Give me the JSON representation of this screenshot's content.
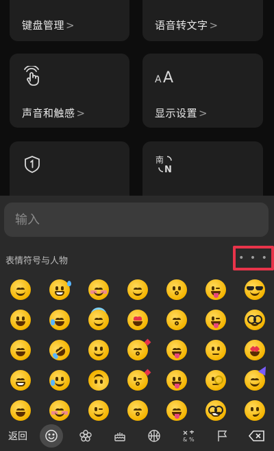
{
  "settings": {
    "keyboard_management": "键盘管理",
    "voice_to_text": "语音转文字",
    "sound_and_touch": "声音和触感",
    "display_settings": "显示设置",
    "chevron": ">"
  },
  "keyboard": {
    "input_placeholder": "输入",
    "category_title": "表情符号与人物",
    "more_label": "• • •",
    "back_label": "返回"
  },
  "emojis": [
    [
      "smile",
      "sweat-smile",
      "blush",
      "relieved",
      "kissing",
      "wink-tongue",
      "sunglasses"
    ],
    [
      "smiley",
      "joy",
      "innocent",
      "heart-eyes",
      "kissing-smiling",
      "zany",
      "disguised"
    ],
    [
      "grin-smile",
      "rofl",
      "slight-smile",
      "smiling-hearts",
      "savoring",
      "raised-eyebrow",
      "star-struck"
    ],
    [
      "grimace",
      "tear-smile",
      "upside-down",
      "kissing-heart",
      "tongue",
      "monocle",
      "partying"
    ],
    [
      "squint-laugh",
      "happy",
      "wink",
      "kissing-closed",
      "squint-tongue",
      "nerd",
      "smirk"
    ]
  ],
  "bottom_tabs": [
    "smiley-tab",
    "flower-tab",
    "cake-tab",
    "ball-tab",
    "symbols-tab",
    "flag-tab",
    "delete-key"
  ]
}
